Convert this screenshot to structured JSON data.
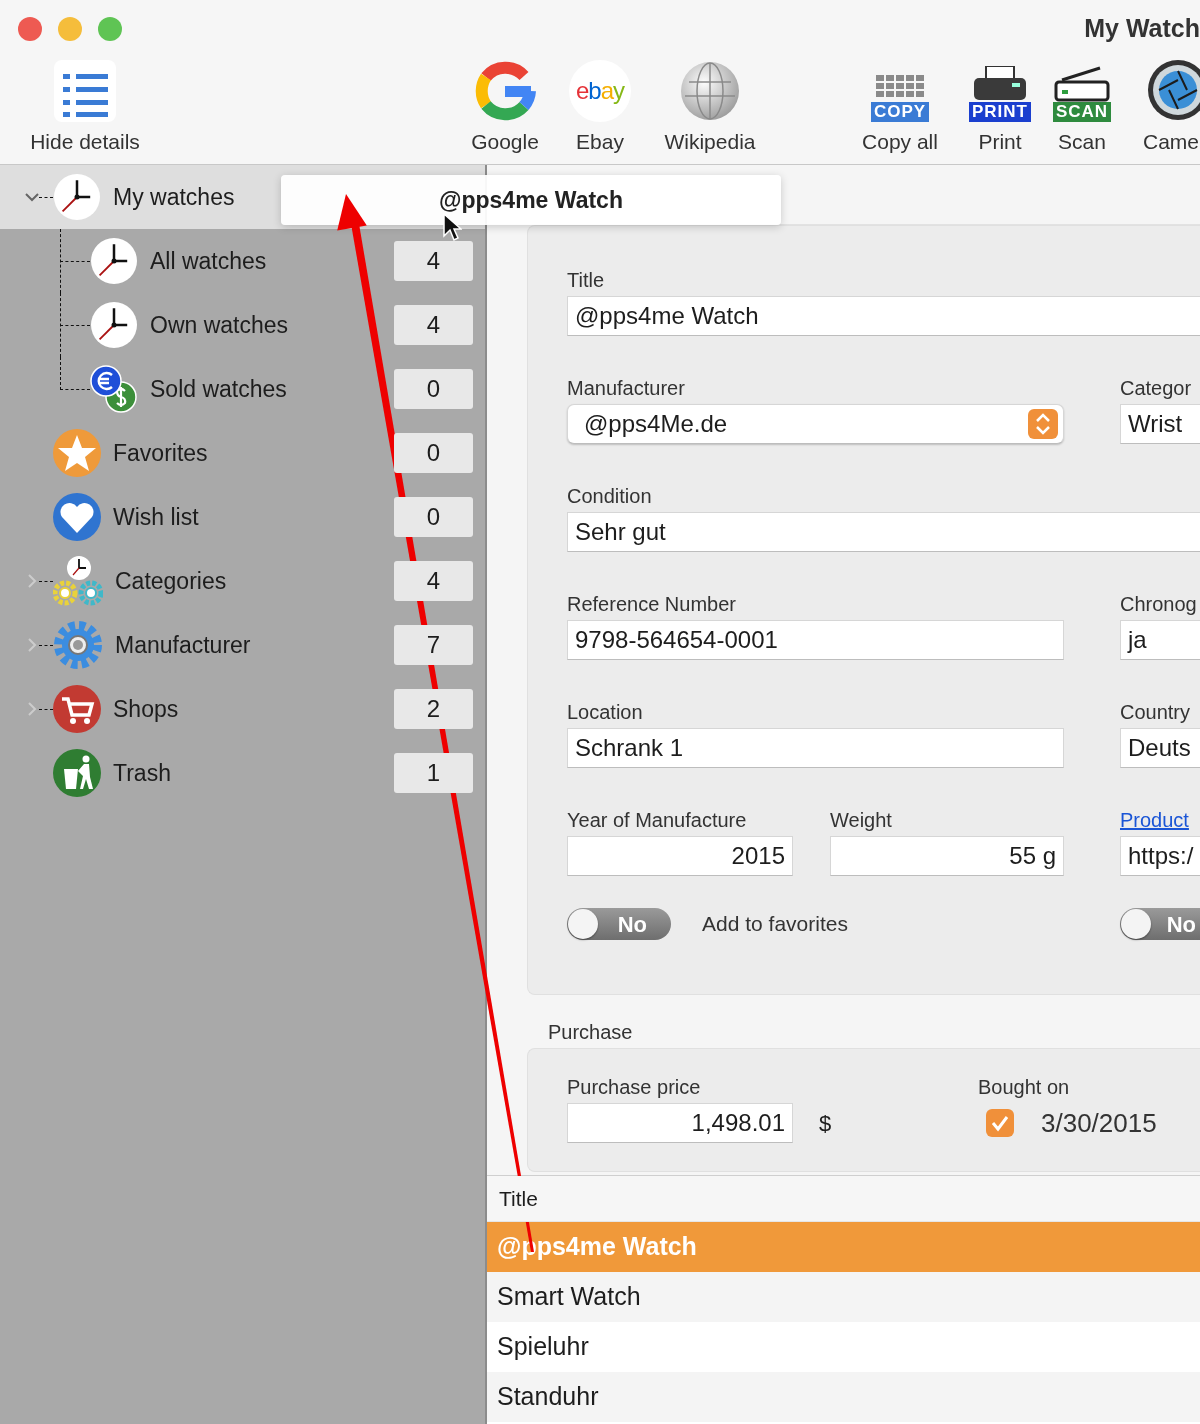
{
  "window": {
    "title": "My Watch"
  },
  "toolbar": [
    {
      "label": "Hide details"
    },
    {
      "label": "Google"
    },
    {
      "label": "Ebay",
      "logo": "ebay"
    },
    {
      "label": "Wikipedia"
    },
    {
      "label": "Copy all",
      "badge": "COPY"
    },
    {
      "label": "Print",
      "badge": "PRINT"
    },
    {
      "label": "Scan",
      "badge": "SCAN"
    },
    {
      "label": "Came"
    }
  ],
  "sidebar": {
    "items": [
      {
        "label": "My watches",
        "selected": true,
        "expanded": true,
        "children": [
          {
            "label": "All watches",
            "count": "4",
            "selected": false
          },
          {
            "label": "Own watches",
            "count": "4",
            "selected": false
          },
          {
            "label": "Sold watches",
            "count": "0",
            "selected": false
          }
        ]
      },
      {
        "label": "Favorites",
        "count": "0",
        "selected": false
      },
      {
        "label": "Wish list",
        "count": "0",
        "selected": false
      },
      {
        "label": "Categories",
        "count": "4",
        "selected": false,
        "expanded": false
      },
      {
        "label": "Manufacturer",
        "count": "7",
        "selected": false,
        "expanded": false
      },
      {
        "label": "Shops",
        "count": "2",
        "selected": false,
        "expanded": false
      },
      {
        "label": "Trash",
        "count": "1",
        "selected": false
      }
    ]
  },
  "drag_preview": {
    "label": "@pps4me Watch"
  },
  "basic_data": {
    "rows": [
      [
        {
          "kind": "text",
          "label": "Title",
          "value": "@pps4me Watch"
        }
      ],
      [
        {
          "kind": "select",
          "label": "Manufacturer",
          "value": "@pps4Me.de"
        },
        {
          "kind": "text",
          "label": "Categor",
          "value": "Wrist"
        }
      ],
      [
        {
          "kind": "text",
          "label": "Condition",
          "value": "Sehr gut"
        }
      ],
      [
        {
          "kind": "text",
          "label": "Reference Number",
          "value": "9798-564654-0001"
        },
        {
          "kind": "text",
          "label": "Chronog",
          "value": "ja"
        }
      ],
      [
        {
          "kind": "text",
          "label": "Location",
          "value": "Schrank 1"
        },
        {
          "kind": "text",
          "label": "Country",
          "value": "Deuts"
        }
      ],
      [
        {
          "kind": "number",
          "label": "Year of Manufacture",
          "value": "2015"
        },
        {
          "kind": "number",
          "label": "Weight",
          "value": "55 g"
        },
        {
          "kind": "link",
          "label": "Product",
          "value": "https:/"
        }
      ],
      [
        {
          "kind": "toggle",
          "value": "No",
          "on": false,
          "label": "Add to favorites"
        },
        {
          "kind": "toggle",
          "value": "No",
          "on": false
        }
      ]
    ]
  },
  "purchase": {
    "title": "Purchase",
    "price_label": "Purchase price",
    "price": "1,498.01",
    "currency": "$",
    "date_label": "Bought on",
    "date_checked": true,
    "date": "3/30/2015"
  },
  "table": {
    "columns": [
      "Title"
    ],
    "rows": [
      {
        "title": "@pps4me Watch",
        "selected": true
      },
      {
        "title": "Smart Watch",
        "selected": false
      },
      {
        "title": "Spieluhr",
        "selected": false
      },
      {
        "title": "Standuhr",
        "selected": false
      }
    ]
  }
}
